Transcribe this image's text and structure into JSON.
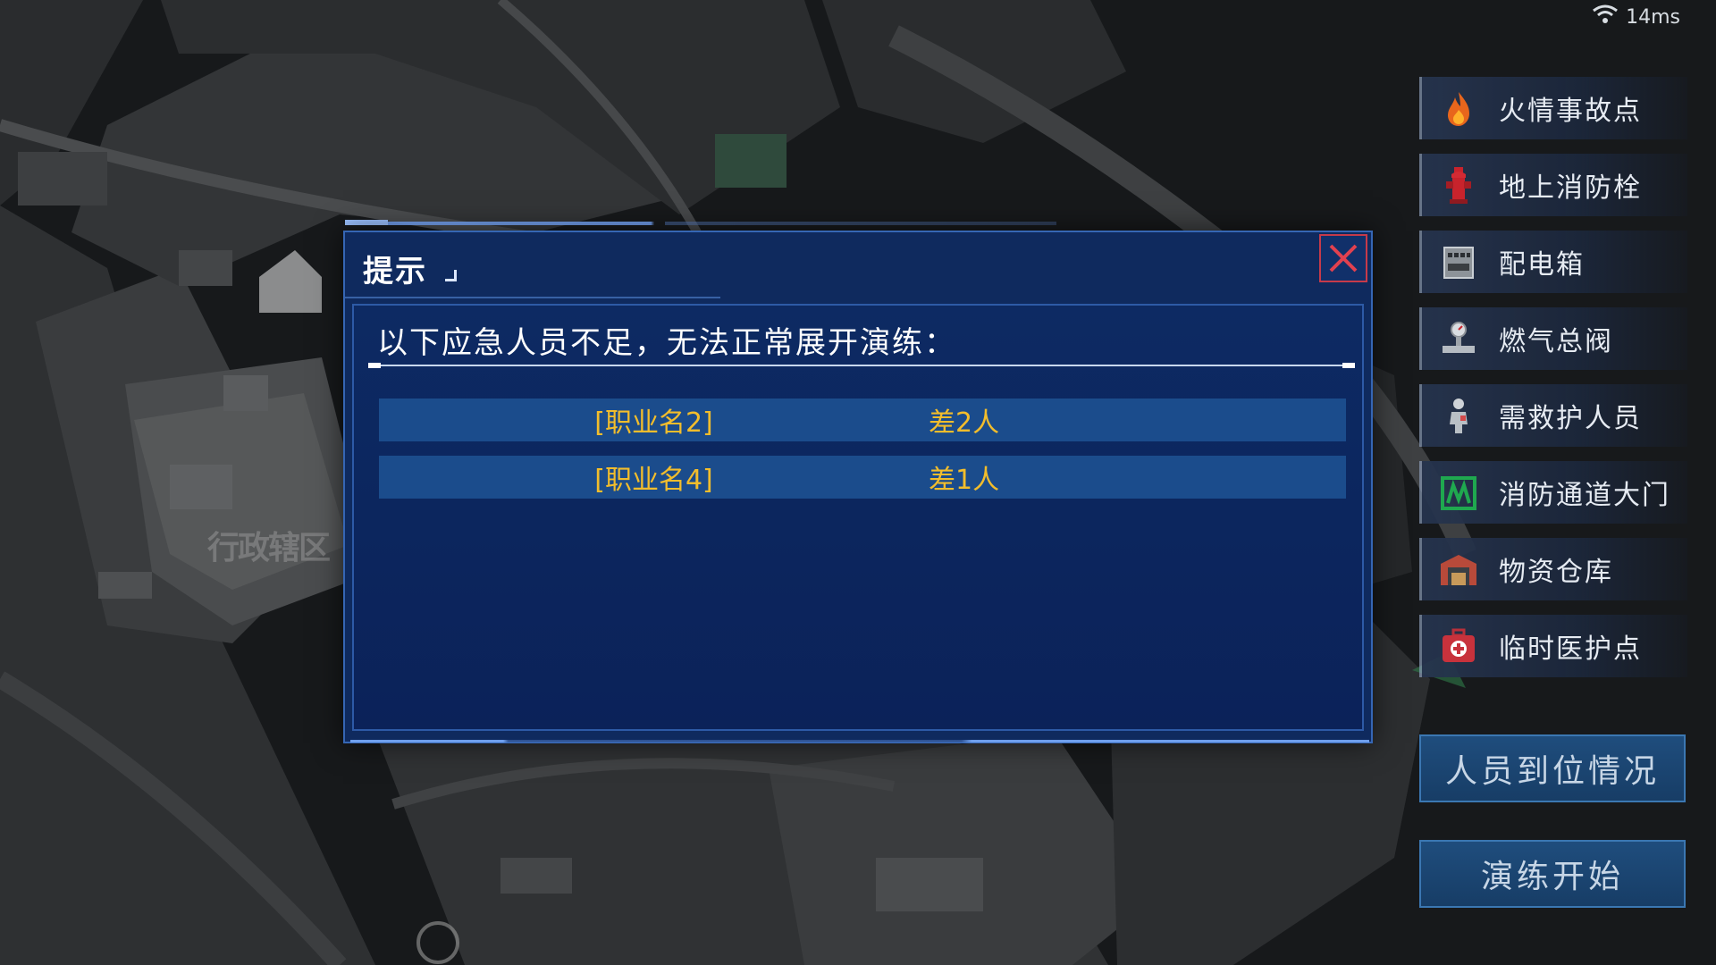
{
  "status": {
    "latency": "14ms"
  },
  "map": {
    "area_label": "行政辖区"
  },
  "legend": [
    {
      "label": "火情事故点",
      "icon": "fire-icon"
    },
    {
      "label": "地上消防栓",
      "icon": "hydrant-icon"
    },
    {
      "label": "配电箱",
      "icon": "power-box-icon"
    },
    {
      "label": "燃气总阀",
      "icon": "gas-valve-icon"
    },
    {
      "label": "需救护人员",
      "icon": "injured-person-icon"
    },
    {
      "label": "消防通道大门",
      "icon": "fire-gate-icon"
    },
    {
      "label": "物资仓库",
      "icon": "warehouse-icon"
    },
    {
      "label": "临时医护点",
      "icon": "first-aid-icon"
    }
  ],
  "buttons": {
    "presence": "人员到位情况",
    "start": "演练开始"
  },
  "dialog": {
    "title": "提示",
    "message": "以下应急人员不足，无法正常展开演练：",
    "rows": [
      {
        "role": "[职业名2]",
        "shortage": "差2人"
      },
      {
        "role": "[职业名4]",
        "shortage": "差1人"
      }
    ]
  },
  "colors": {
    "accent": "#f2bd2c",
    "dialog_bg": "#0f2a5e",
    "close_border": "#c63a4a"
  }
}
